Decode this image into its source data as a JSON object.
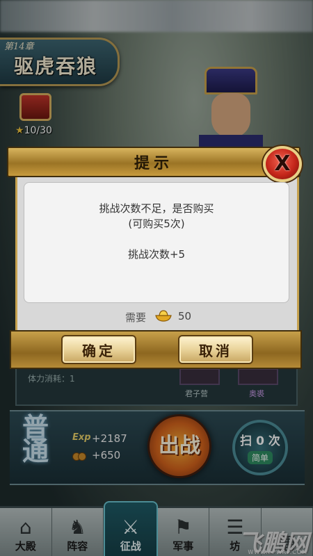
{
  "chapter": {
    "number": "第14章",
    "title": "驱虎吞狼",
    "stars": "10/30"
  },
  "dialog": {
    "title": "提示",
    "message_line1": "挑战次数不足，是否购买",
    "message_line2": "(可购买5次)",
    "message_line3": "挑战次数+5",
    "cost_label": "需要",
    "cost_value": "50",
    "confirm_label": "确定",
    "cancel_label": "取消",
    "close_label": "X"
  },
  "stage": {
    "stamina_label": "体力消耗：1",
    "reward1_name": "君子营",
    "reward2_name": "奥裘",
    "difficulty": "普通",
    "exp_label": "Exp",
    "exp_value": "+2187",
    "coin_value": "+650",
    "fight_label": "出战",
    "sweep_label": "扫 0 次",
    "sweep_sub_label": "简单"
  },
  "nav": {
    "items": [
      {
        "label": "大殿",
        "icon": "palace-icon"
      },
      {
        "label": "阵容",
        "icon": "helmet-icon"
      },
      {
        "label": "征战",
        "icon": "crossed-swords-icon"
      },
      {
        "label": "军事",
        "icon": "flag-icon"
      },
      {
        "label": "坊",
        "icon": "workshop-icon"
      },
      {
        "label": "",
        "icon": "grid-icon"
      }
    ],
    "active_index": 2
  },
  "watermark": {
    "text": "飞鹏网",
    "url": "WWW.FPWAP.COM"
  },
  "colors": {
    "gold_frame": "#c6a24f",
    "close_red": "#c4261a",
    "nav_active": "#1f5b66",
    "fight_orange": "#d2621c"
  }
}
